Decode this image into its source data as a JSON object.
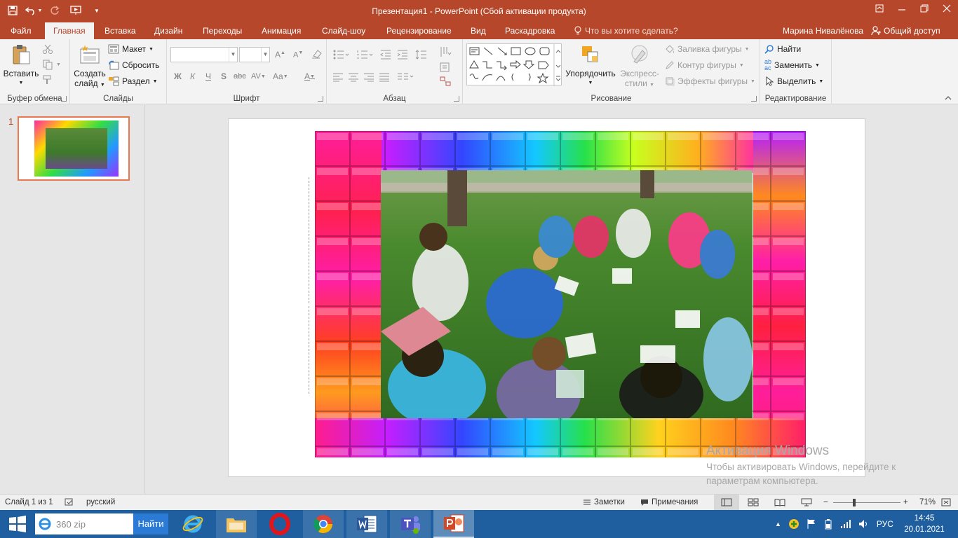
{
  "window": {
    "title": "Презентация1 - PowerPoint (Сбой активации продукта)",
    "accent": "#b7472a"
  },
  "tabs": [
    {
      "label": "Файл"
    },
    {
      "label": "Главная",
      "active": true
    },
    {
      "label": "Вставка"
    },
    {
      "label": "Дизайн"
    },
    {
      "label": "Переходы"
    },
    {
      "label": "Анимация"
    },
    {
      "label": "Слайд-шоу"
    },
    {
      "label": "Рецензирование"
    },
    {
      "label": "Вид"
    },
    {
      "label": "Раскадровка"
    }
  ],
  "tell_me": "Что вы хотите сделать?",
  "user": "Марина Нивалёнова",
  "share": "Общий доступ",
  "ribbon": {
    "clipboard": {
      "paste": "Вставить",
      "label": "Буфер обмена"
    },
    "slides": {
      "new_slide_1": "Создать",
      "new_slide_2": "слайд",
      "layout": "Макет",
      "reset": "Сбросить",
      "section": "Раздел",
      "label": "Слайды"
    },
    "font": {
      "label": "Шрифт",
      "bold": "Ж",
      "italic": "К",
      "underline": "Ч",
      "shadow": "S",
      "strike": "abc",
      "spacing": "AV",
      "case": "Aa",
      "color": "A"
    },
    "paragraph": {
      "label": "Абзац"
    },
    "drawing": {
      "arrange": "Упорядочить",
      "styles_1": "Экспресс-",
      "styles_2": "стили",
      "fill": "Заливка фигуры",
      "outline": "Контур фигуры",
      "effects": "Эффекты фигуры",
      "label": "Рисование"
    },
    "editing": {
      "find": "Найти",
      "replace": "Заменить",
      "select": "Выделить",
      "label": "Редактирование"
    }
  },
  "thumbnails": [
    {
      "number": "1"
    }
  ],
  "watermark": {
    "title": "Активация Windows",
    "line1": "Чтобы активировать Windows, перейдите к",
    "line2": "параметрам компьютера."
  },
  "status": {
    "slide": "Слайд 1 из 1",
    "language": "русский",
    "notes": "Заметки",
    "comments": "Примечания",
    "zoom": "71%"
  },
  "taskbar": {
    "search_value": "360 zip",
    "search_button": "Найти",
    "lang": "РУС",
    "time": "14:45",
    "date": "20.01.2021"
  }
}
